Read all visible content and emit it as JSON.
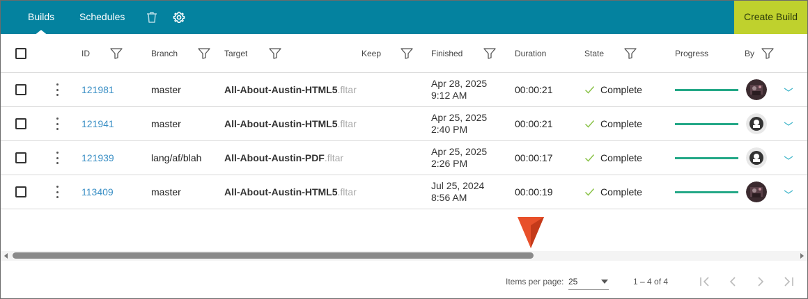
{
  "header": {
    "tabs": [
      {
        "label": "Builds",
        "active": true
      },
      {
        "label": "Schedules",
        "active": false
      }
    ],
    "icons": [
      "trash-icon",
      "gear-icon"
    ],
    "create_label": "Create Build",
    "accent": "#04829f",
    "create_color": "#bfd12d"
  },
  "columns": {
    "id": "ID",
    "branch": "Branch",
    "target": "Target",
    "keep": "Keep",
    "finished": "Finished",
    "duration": "Duration",
    "state": "State",
    "progress": "Progress",
    "by": "By"
  },
  "rows": [
    {
      "id": "121981",
      "branch": "master",
      "target": "All-About-Austin-HTML5",
      "ext": ".fltar",
      "finished_date": "Apr 28, 2025",
      "finished_time": "9:12 AM",
      "duration": "00:00:21",
      "state": "Complete",
      "progress": 1.0,
      "avatar": "dark-photo"
    },
    {
      "id": "121941",
      "branch": "master",
      "target": "All-About-Austin-HTML5",
      "ext": ".fltar",
      "finished_date": "Apr 25, 2025",
      "finished_time": "2:40 PM",
      "duration": "00:00:21",
      "state": "Complete",
      "progress": 1.0,
      "avatar": "logo-badge"
    },
    {
      "id": "121939",
      "branch": "lang/af/blah",
      "target": "All-About-Austin-PDF",
      "ext": ".fltar",
      "finished_date": "Apr 25, 2025",
      "finished_time": "2:26 PM",
      "duration": "00:00:17",
      "state": "Complete",
      "progress": 1.0,
      "avatar": "logo-badge"
    },
    {
      "id": "113409",
      "branch": "master",
      "target": "All-About-Austin-HTML5",
      "ext": ".fltar",
      "finished_date": "Jul 25, 2024",
      "finished_time": "8:56 AM",
      "duration": "00:00:19",
      "state": "Complete",
      "progress": 1.0,
      "avatar": "dark-photo"
    }
  ],
  "paginator": {
    "items_per_page_label": "Items per page:",
    "items_per_page_value": "25",
    "range_label": "1 – 4 of 4"
  }
}
